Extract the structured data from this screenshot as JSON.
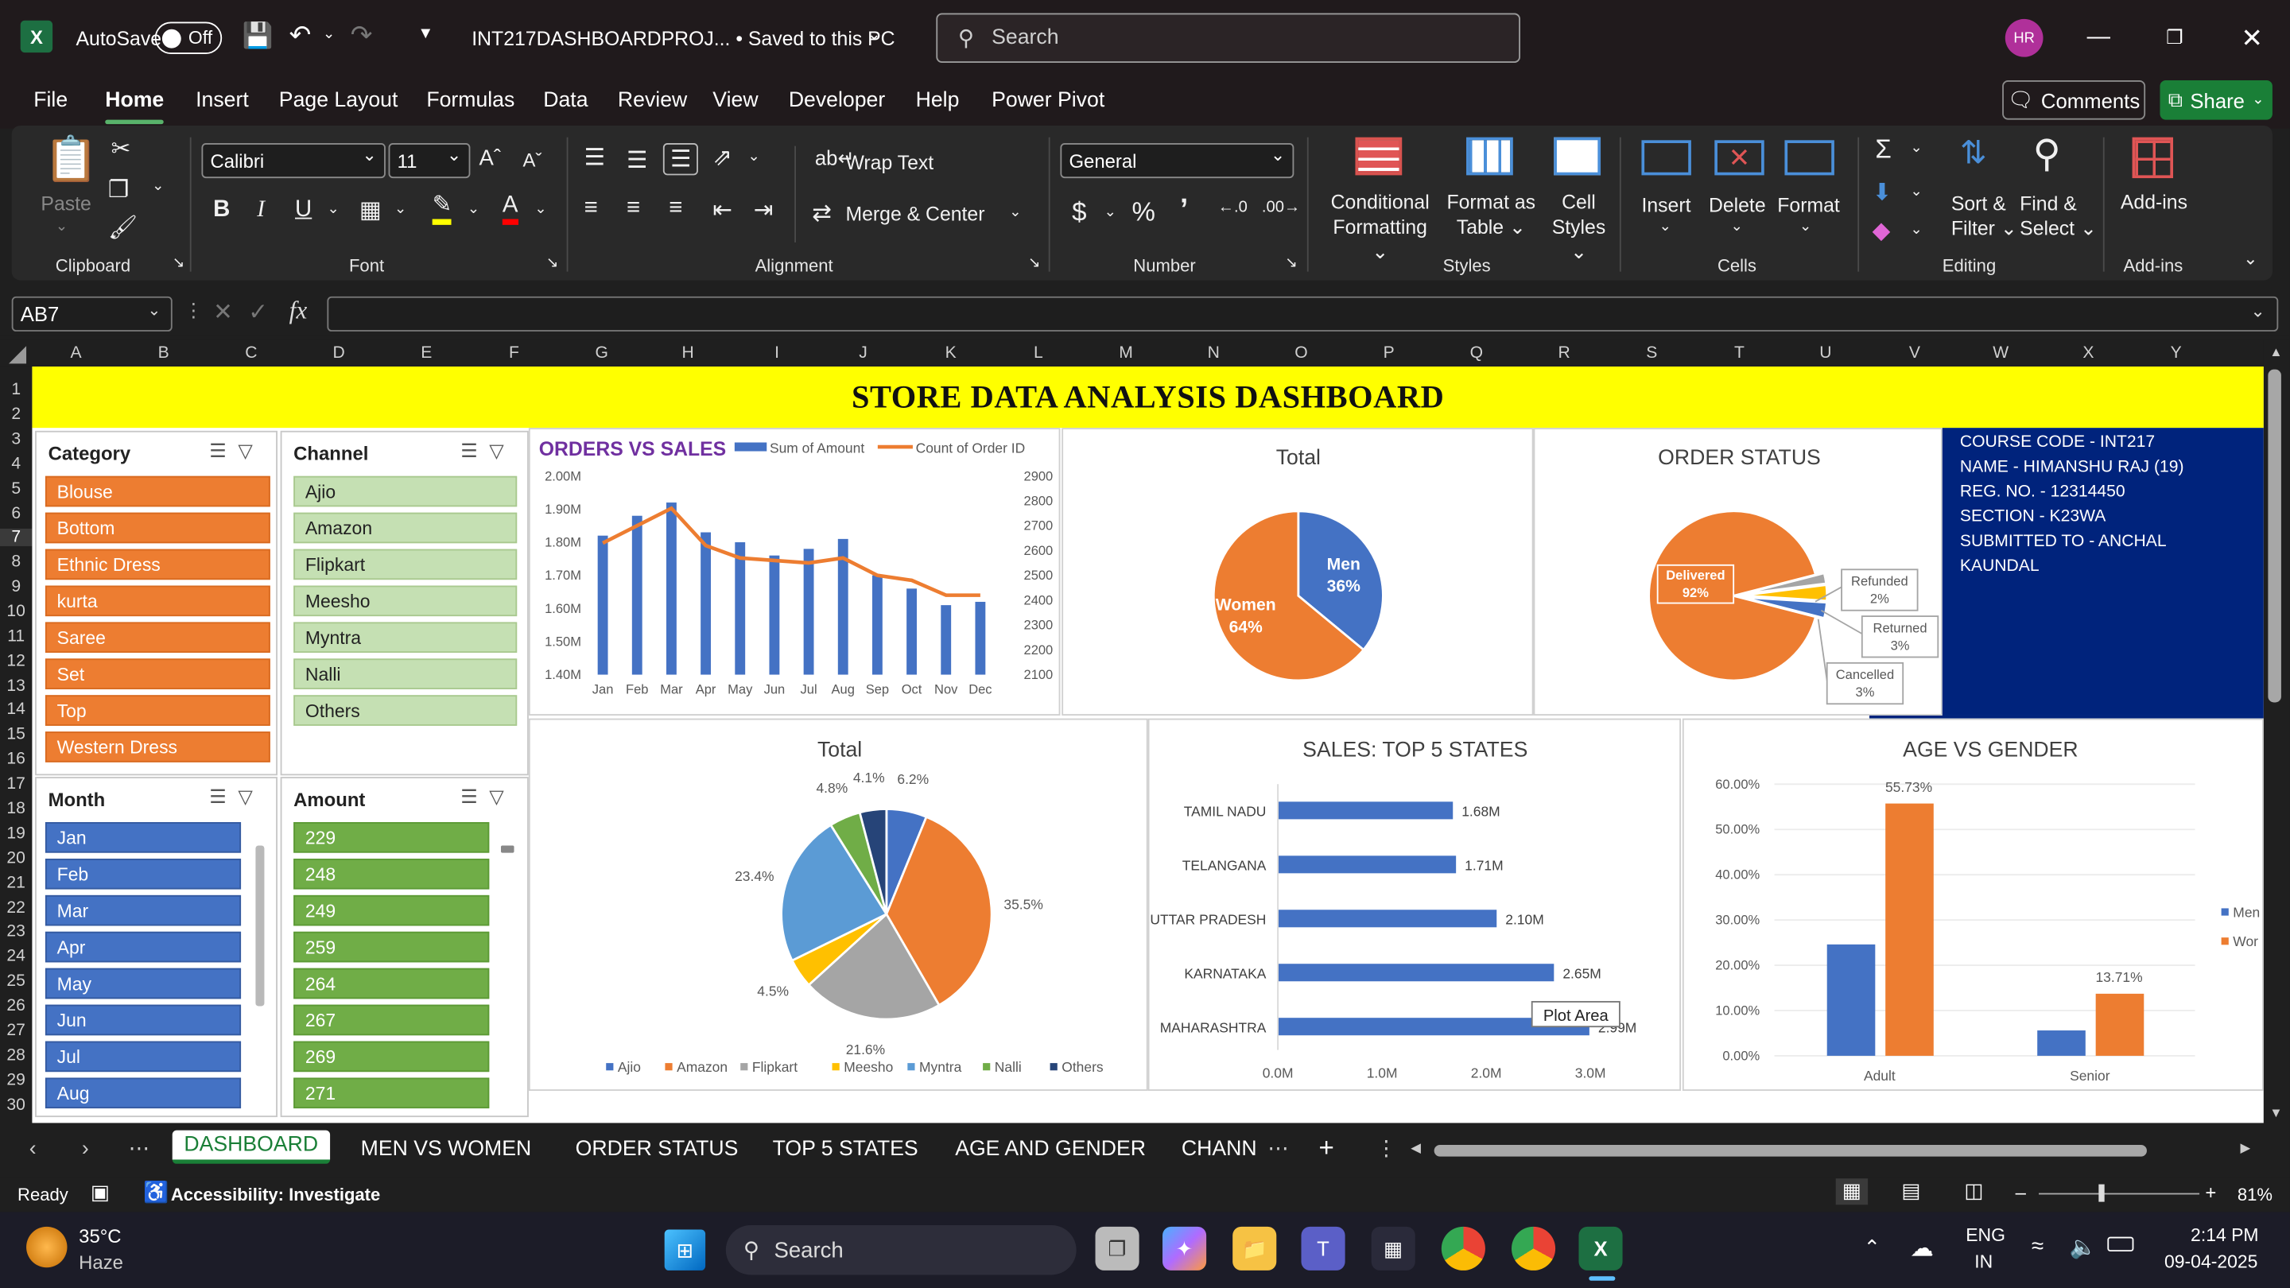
{
  "titlebar": {
    "autosave_label": "AutoSave",
    "autosave_state": "Off",
    "filename": "INT217DASHBOARDPROJ... • Saved to this PC",
    "search_placeholder": "Search",
    "avatar": "HR"
  },
  "menu": {
    "items": [
      "File",
      "Home",
      "Insert",
      "Page Layout",
      "Formulas",
      "Data",
      "Review",
      "View",
      "Developer",
      "Help",
      "Power Pivot"
    ],
    "active": "Home",
    "comments": "Comments",
    "share": "Share"
  },
  "ribbon": {
    "clipboard": {
      "paste": "Paste",
      "label": "Clipboard"
    },
    "font": {
      "name": "Calibri",
      "size": "11",
      "label": "Font"
    },
    "alignment": {
      "wrap": "Wrap Text",
      "merge": "Merge & Center",
      "label": "Alignment"
    },
    "number": {
      "format": "General",
      "label": "Number"
    },
    "styles": {
      "conditional": "Conditional",
      "conditional2": "Formatting",
      "format_table": "Format as",
      "format_table2": "Table",
      "cell": "Cell",
      "cell2": "Styles",
      "label": "Styles"
    },
    "cells": {
      "insert": "Insert",
      "delete": "Delete",
      "format": "Format",
      "label": "Cells"
    },
    "editing": {
      "sort": "Sort &",
      "sort2": "Filter",
      "find": "Find &",
      "find2": "Select",
      "label": "Editing"
    },
    "addins": {
      "button": "Add-ins",
      "label": "Add-ins"
    }
  },
  "formula_bar": {
    "namebox": "AB7",
    "fx": "fx",
    "content": ""
  },
  "columns": [
    "A",
    "B",
    "C",
    "D",
    "E",
    "F",
    "G",
    "H",
    "I",
    "J",
    "K",
    "L",
    "M",
    "N",
    "O",
    "P",
    "Q",
    "R",
    "S",
    "T",
    "U",
    "V",
    "W",
    "X",
    "Y"
  ],
  "rows": [
    "1",
    "2",
    "3",
    "4",
    "5",
    "6",
    "7",
    "8",
    "9",
    "10",
    "11",
    "12",
    "13",
    "14",
    "15",
    "16",
    "17",
    "18",
    "19",
    "20",
    "21",
    "22",
    "23",
    "24",
    "25",
    "26",
    "27",
    "28",
    "29",
    "30"
  ],
  "dashboard": {
    "title": "STORE DATA ANALYSIS DASHBOARD",
    "info": [
      "COURSE CODE - INT217",
      "NAME - HIMANSHU RAJ (19)",
      "REG. NO. - 12314450",
      "SECTION - K23WA",
      "SUBMITTED TO - ANCHAL KAUNDAL"
    ]
  },
  "slicers": {
    "category": {
      "title": "Category",
      "items": [
        "Blouse",
        "Bottom",
        "Ethnic Dress",
        "kurta",
        "Saree",
        "Set",
        "Top",
        "Western Dress"
      ]
    },
    "channel": {
      "title": "Channel",
      "items": [
        "Ajio",
        "Amazon",
        "Flipkart",
        "Meesho",
        "Myntra",
        "Nalli",
        "Others"
      ]
    },
    "month": {
      "title": "Month",
      "items": [
        "Jan",
        "Feb",
        "Mar",
        "Apr",
        "May",
        "Jun",
        "Jul",
        "Aug"
      ]
    },
    "amount": {
      "title": "Amount",
      "items": [
        "229",
        "248",
        "249",
        "259",
        "264",
        "267",
        "269",
        "271"
      ]
    }
  },
  "chart_data": [
    {
      "type": "bar",
      "title": "ORDERS VS SALES",
      "categories": [
        "Jan",
        "Feb",
        "Mar",
        "Apr",
        "May",
        "Jun",
        "Jul",
        "Aug",
        "Sep",
        "Oct",
        "Nov",
        "Dec"
      ],
      "series": [
        {
          "name": "Sum of Amount",
          "type": "bar",
          "axis": "left",
          "values": [
            1.82,
            1.88,
            1.92,
            1.83,
            1.8,
            1.76,
            1.78,
            1.81,
            1.7,
            1.66,
            1.61,
            1.62
          ]
        },
        {
          "name": "Count of Order ID",
          "type": "line",
          "axis": "right",
          "values": [
            2630,
            2700,
            2770,
            2620,
            2570,
            2560,
            2550,
            2570,
            2500,
            2480,
            2420,
            2420
          ]
        }
      ],
      "ylim_left": [
        1.4,
        2.0
      ],
      "yticks_left": [
        "1.40M",
        "1.50M",
        "1.60M",
        "1.70M",
        "1.80M",
        "1.90M",
        "2.00M"
      ],
      "ylim_right": [
        2100,
        2900
      ],
      "yticks_right": [
        "2100",
        "2200",
        "2300",
        "2400",
        "2500",
        "2600",
        "2700",
        "2800",
        "2900"
      ],
      "colors": {
        "bar": "#4472c4",
        "line": "#ed7d31"
      }
    },
    {
      "type": "pie",
      "title": "Total",
      "labels": [
        "Men",
        "Women"
      ],
      "values": [
        36,
        64
      ],
      "data_labels": [
        "36%",
        "64%"
      ],
      "colors": [
        "#4472c4",
        "#ed7d31"
      ]
    },
    {
      "type": "pie",
      "title": "ORDER STATUS",
      "labels": [
        "Delivered",
        "Refunded",
        "Returned",
        "Cancelled"
      ],
      "values": [
        92,
        2,
        3,
        3
      ],
      "data_labels": [
        "92%",
        "2%",
        "3%",
        "3%"
      ],
      "colors": [
        "#ed7d31",
        "#a5a5a5",
        "#ffc000",
        "#4472c4"
      ]
    },
    {
      "type": "pie",
      "title": "Total",
      "labels": [
        "Ajio",
        "Amazon",
        "Flipkart",
        "Meesho",
        "Myntra",
        "Nalli",
        "Others"
      ],
      "values": [
        6.2,
        35.5,
        21.6,
        4.5,
        23.4,
        4.8,
        4.1
      ],
      "data_labels": [
        "6.2%",
        "35.5%",
        "21.6%",
        "4.5%",
        "23.4%",
        "4.8%",
        "4.1%"
      ],
      "colors": [
        "#4472c4",
        "#ed7d31",
        "#a5a5a5",
        "#ffc000",
        "#5b9bd5",
        "#70ad47",
        "#264478"
      ]
    },
    {
      "type": "bar",
      "orientation": "horizontal",
      "title": "SALES: TOP 5 STATES",
      "categories": [
        "TAMIL NADU",
        "TELANGANA",
        "UTTAR PRADESH",
        "KARNATAKA",
        "MAHARASHTRA"
      ],
      "values": [
        1.68,
        1.71,
        2.1,
        2.65,
        2.99
      ],
      "data_labels": [
        "1.68M",
        "1.71M",
        "2.10M",
        "2.65M",
        "2.99M"
      ],
      "xlim": [
        0,
        3.0
      ],
      "xticks": [
        "0.0M",
        "1.0M",
        "2.0M",
        "3.0M"
      ],
      "tooltip": "Plot Area",
      "color": "#4472c4"
    },
    {
      "type": "bar",
      "title": "AGE VS GENDER",
      "categories": [
        "Adult",
        "Senior"
      ],
      "series": [
        {
          "name": "Men",
          "values": [
            24.6,
            5.6
          ]
        },
        {
          "name": "Women",
          "values": [
            55.73,
            13.71
          ]
        }
      ],
      "data_labels": [
        "55.73%",
        "13.71%"
      ],
      "ylim": [
        0,
        60
      ],
      "yticks": [
        "0.00%",
        "10.00%",
        "20.00%",
        "30.00%",
        "40.00%",
        "50.00%",
        "60.00%"
      ],
      "legend_labels": [
        "Men",
        "Wor"
      ],
      "colors": [
        "#4472c4",
        "#ed7d31"
      ]
    }
  ],
  "sheet_tabs": [
    "DASHBOARD",
    "MEN VS WOMEN",
    "ORDER STATUS",
    "TOP 5 STATES",
    "AGE AND GENDER",
    "CHANN"
  ],
  "status": {
    "ready": "Ready",
    "accessibility": "Accessibility: Investigate",
    "zoom": "81%"
  },
  "taskbar": {
    "weather_temp": "35°C",
    "weather_desc": "Haze",
    "search": "Search",
    "lang1": "ENG",
    "lang2": "IN",
    "time": "2:14 PM",
    "date": "09-04-2025"
  }
}
